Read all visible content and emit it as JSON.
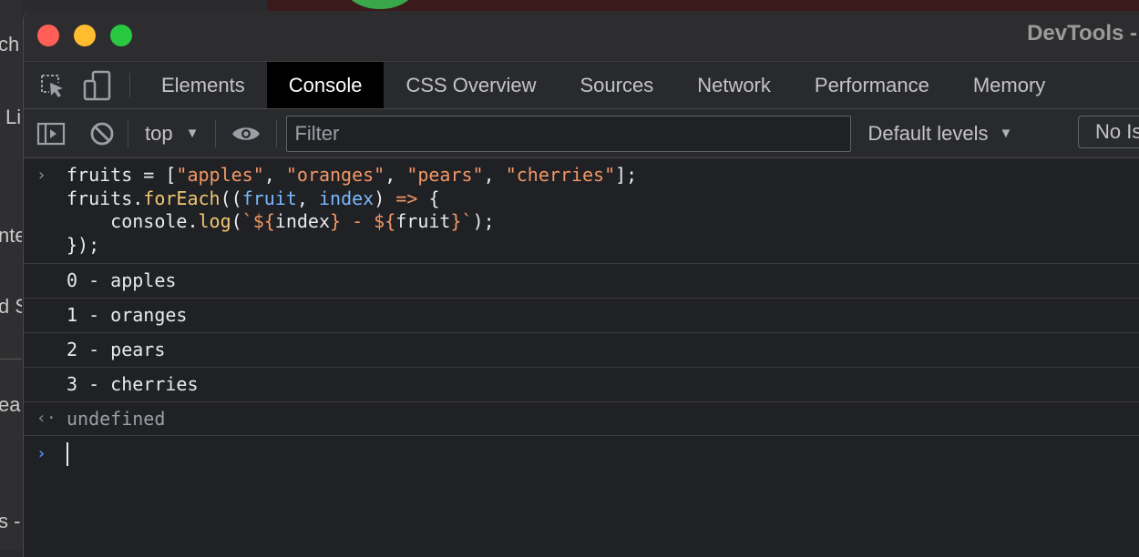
{
  "background": {
    "left_fragments": [
      "ch",
      "Li",
      "nte",
      "d S",
      "ea",
      "s -"
    ]
  },
  "window": {
    "title": "DevTools -",
    "controls": [
      "close",
      "minimize",
      "maximize"
    ]
  },
  "tabs": [
    {
      "label": "Elements"
    },
    {
      "label": "Console",
      "active": true
    },
    {
      "label": "CSS Overview"
    },
    {
      "label": "Sources"
    },
    {
      "label": "Network"
    },
    {
      "label": "Performance"
    },
    {
      "label": "Memory"
    }
  ],
  "toolbar": {
    "context": "top",
    "filter_placeholder": "Filter",
    "levels": "Default levels",
    "issues": "No Is"
  },
  "console": {
    "input": {
      "line1": {
        "a": "fruits ",
        "b": "= [",
        "s1": "\"apples\"",
        "c1": ", ",
        "s2": "\"oranges\"",
        "c2": ", ",
        "s3": "\"pears\"",
        "c3": ", ",
        "s4": "\"cherries\"",
        "end": "];"
      },
      "line2": {
        "a": "fruits.",
        "method": "forEach",
        "b": "((",
        "p1": "fruit",
        "c": ", ",
        "p2": "index",
        "d": ") ",
        "arrow": "=>",
        "e": " {"
      },
      "line3": {
        "indent": "    console.",
        "method": "log",
        "open": "(",
        "t1": "`${",
        "v1": "index",
        "t2": "} - ${",
        "v2": "fruit",
        "t3": "}`",
        "close": ");"
      },
      "line4": "});"
    },
    "logs": [
      "0 - apples",
      "1 - oranges",
      "2 - pears",
      "3 - cherries"
    ],
    "result": "undefined",
    "result_glyph": "‹·",
    "input_glyph": "›",
    "prompt_glyph": "›"
  }
}
